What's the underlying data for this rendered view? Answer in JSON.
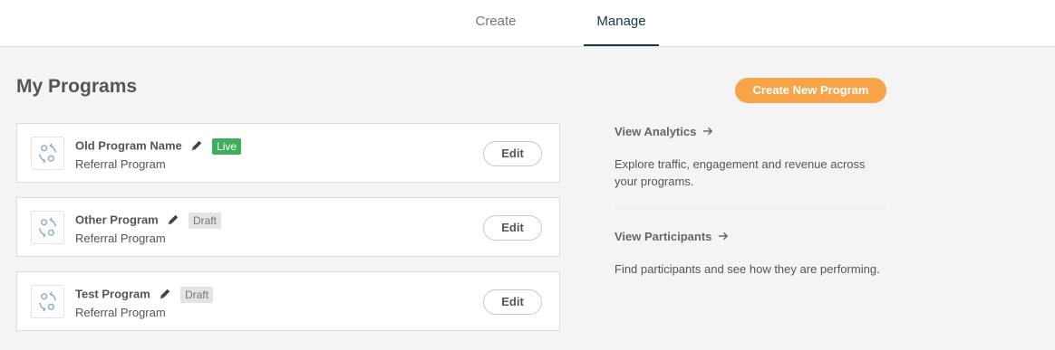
{
  "tabs": [
    {
      "label": "Create"
    },
    {
      "label": "Manage"
    }
  ],
  "page_title": "My Programs",
  "create_button": "Create New Program",
  "programs": [
    {
      "name": "Old Program Name",
      "status": "Live",
      "subtitle": "Referral Program",
      "edit_label": "Edit"
    },
    {
      "name": "Other Program",
      "status": "Draft",
      "subtitle": "Referral Program",
      "edit_label": "Edit"
    },
    {
      "name": "Test Program",
      "status": "Draft",
      "subtitle": "Referral Program",
      "edit_label": "Edit"
    }
  ],
  "sidebar": {
    "analytics": {
      "label": "View Analytics",
      "description": "Explore traffic, engagement and revenue across your programs."
    },
    "participants": {
      "label": "View Participants",
      "description": "Find participants and see how they are performing."
    }
  },
  "icons": {
    "program": "referral-cycle-icon",
    "edit_name": "pencil-icon",
    "link_arrow": "arrow-right-icon"
  },
  "colors": {
    "accent": "#f8a54a",
    "live": "#3fae5b",
    "draft": "#e4e4e4",
    "active_tab": "#123a4a"
  }
}
